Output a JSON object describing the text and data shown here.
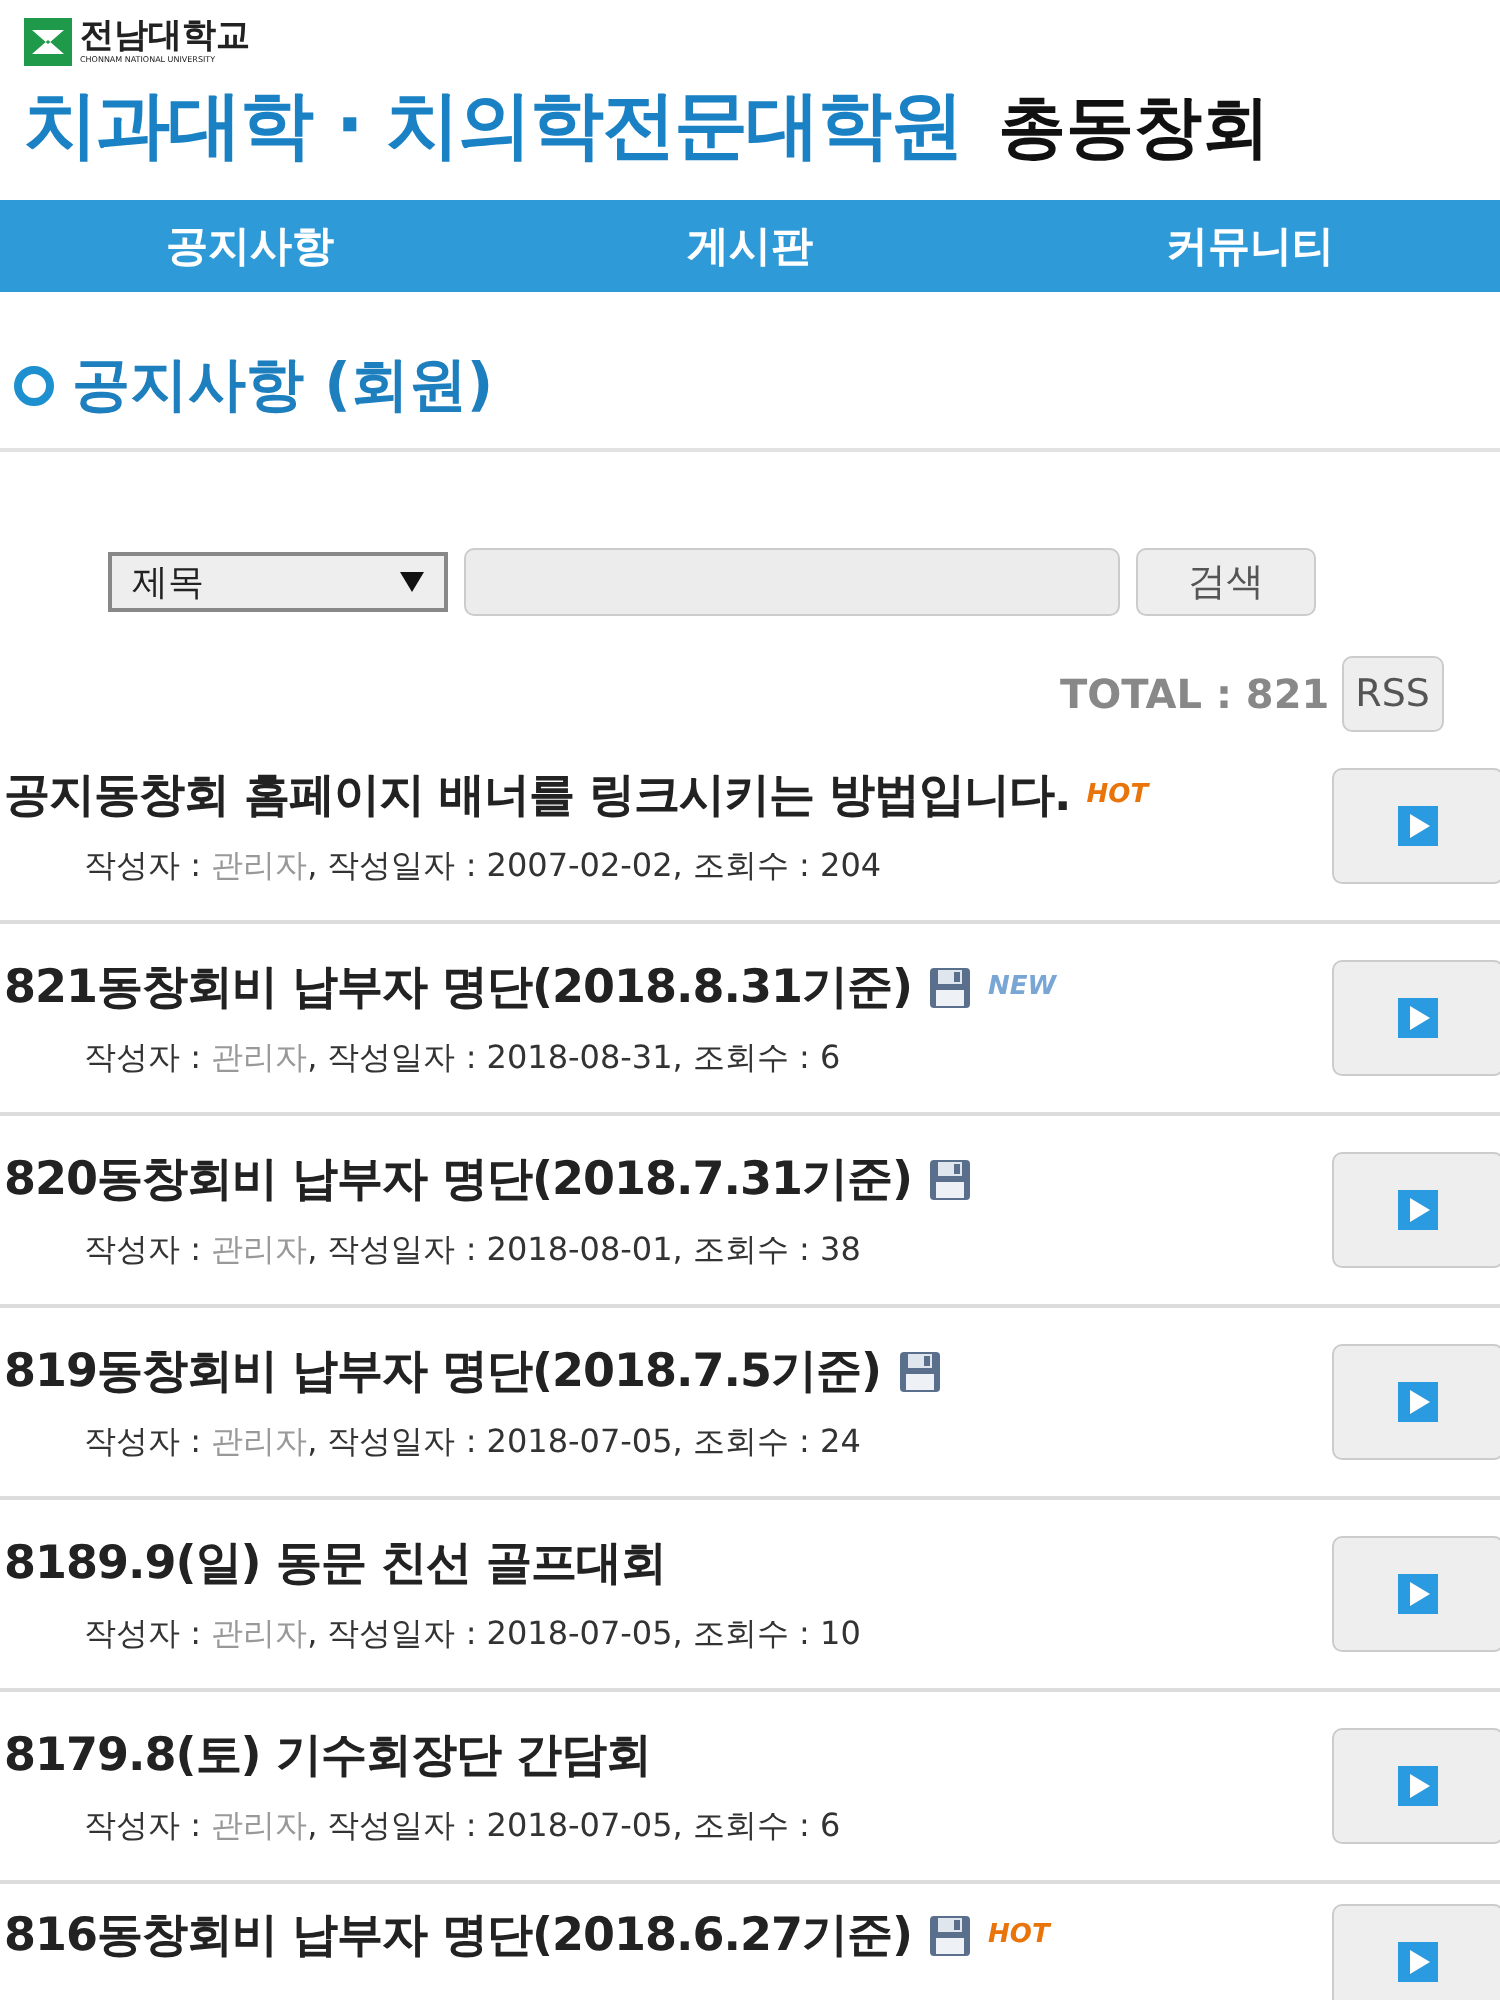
{
  "header": {
    "university": "전남대학교",
    "university_en": "CHONNAM NATIONAL UNIVERSITY",
    "title_main": "치과대학 · 치의학전문대학원",
    "title_suffix": "총동창회"
  },
  "nav": [
    {
      "label": "공지사항"
    },
    {
      "label": "게시판"
    },
    {
      "label": "커뮤니티"
    }
  ],
  "page_heading": "공지사항 (회원)",
  "search": {
    "field_value": "제목",
    "button": "검색"
  },
  "total": "TOTAL : 821",
  "rss_button": "RSS",
  "posts": [
    {
      "title": "공지동창회 홈페이지 배너를 링크시키는 방법입니다.",
      "badge": {
        "kind": "hot",
        "text": "HOT"
      },
      "attachment": false,
      "author_label": "작성자 : ",
      "author": "관리자",
      "details": ", 작성일자 : 2007-02-02, 조회수 : 204"
    },
    {
      "title": "821동창회비 납부자 명단(2018.8.31기준)",
      "badge": {
        "kind": "new",
        "text": "NEW"
      },
      "attachment": true,
      "author_label": "작성자 : ",
      "author": "관리자",
      "details": ", 작성일자 : 2018-08-31, 조회수 : 6"
    },
    {
      "title": "820동창회비 납부자 명단(2018.7.31기준)",
      "attachment": true,
      "author_label": "작성자 : ",
      "author": "관리자",
      "details": ", 작성일자 : 2018-08-01, 조회수 : 38"
    },
    {
      "title": "819동창회비 납부자 명단(2018.7.5기준)",
      "attachment": true,
      "author_label": "작성자 : ",
      "author": "관리자",
      "details": ", 작성일자 : 2018-07-05, 조회수 : 24"
    },
    {
      "title": "8189.9(일) 동문 친선 골프대회",
      "attachment": false,
      "author_label": "작성자 : ",
      "author": "관리자",
      "details": ", 작성일자 : 2018-07-05, 조회수 : 10"
    },
    {
      "title": "8179.8(토) 기수회장단 간담회",
      "attachment": false,
      "author_label": "작성자 : ",
      "author": "관리자",
      "details": ", 작성일자 : 2018-07-05, 조회수 : 6"
    },
    {
      "title": "816동창회비 납부자 명단(2018.6.27기준)",
      "badge": {
        "kind": "hot",
        "text": "HOT"
      },
      "attachment": true
    }
  ]
}
